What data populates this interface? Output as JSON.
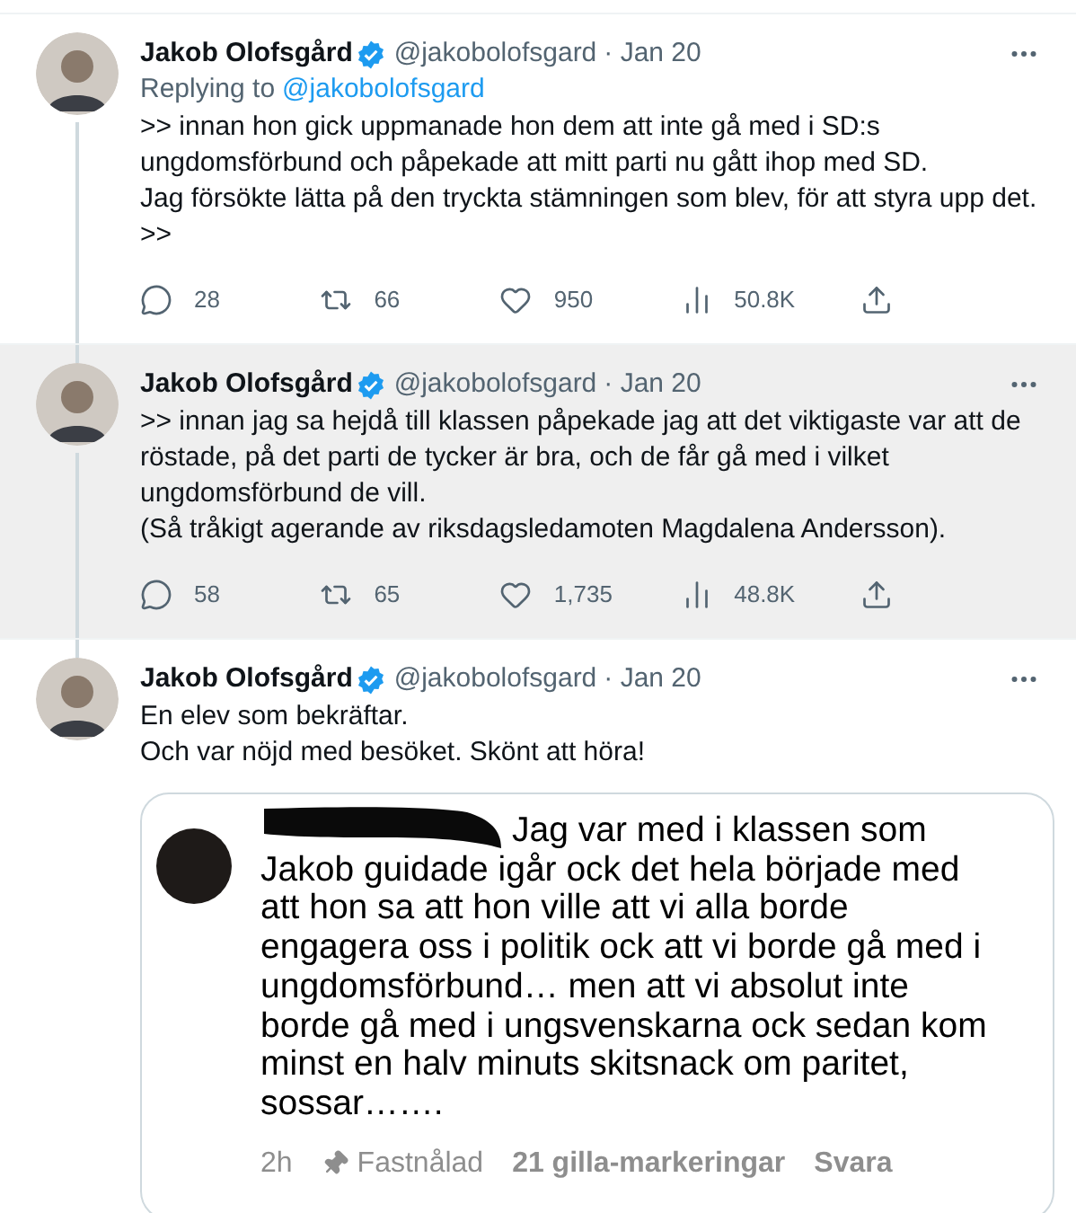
{
  "tweets": [
    {
      "author": "Jakob Olofsgård",
      "verified": true,
      "handle": "@jakobolofsgard",
      "date": "· Jan 20",
      "highlighted": false,
      "replying_label": "Replying to",
      "replying_to": "@jakobolofsgard",
      "paragraphs": [
        ">> innan hon gick uppmanade hon dem att inte gå med i SD:s ungdomsförbund och påpekade att mitt parti nu gått ihop med SD.",
        "Jag försökte lätta på den tryckta stämningen som blev, för att styra upp det.",
        ">>"
      ],
      "stats": {
        "replies": "28",
        "retweets": "66",
        "likes": "950",
        "views": "50.8K"
      }
    },
    {
      "author": "Jakob Olofsgård",
      "verified": true,
      "handle": "@jakobolofsgard",
      "date": "· Jan 20",
      "highlighted": true,
      "paragraphs": [
        ">> innan jag sa hejdå till klassen påpekade jag att det viktigaste var att de röstade, på det parti de tycker är bra, och de får gå med i vilket ungdomsförbund de vill.",
        "(Så tråkigt agerande av riksdagsledamoten Magdalena Andersson)."
      ],
      "stats": {
        "replies": "58",
        "retweets": "65",
        "likes": "1,735",
        "views": "48.8K"
      }
    },
    {
      "author": "Jakob Olofsgård",
      "verified": true,
      "handle": "@jakobolofsgard",
      "date": "· Jan 20",
      "highlighted": false,
      "paragraphs": [
        "En elev som bekräftar.",
        "Och var nöjd med besöket. Skönt att höra!"
      ],
      "attached_screenshot": {
        "comment_lines": [
          "Jag var med i klassen som",
          "Jakob guidade igår ock det hela började med",
          "att hon sa att hon ville att vi alla borde",
          "engagera oss i politik ock att vi borde gå med i",
          "ungdomsförbund… men att vi absolut inte",
          "borde gå med i ungsvenskarna ock sedan kom",
          "minst en halv minuts skitsnack om paritet,",
          "sossar……."
        ],
        "time": "2h",
        "pinned": "Fastnålad",
        "likes": "21 gilla-markeringar",
        "reply": "Svara"
      }
    }
  ]
}
